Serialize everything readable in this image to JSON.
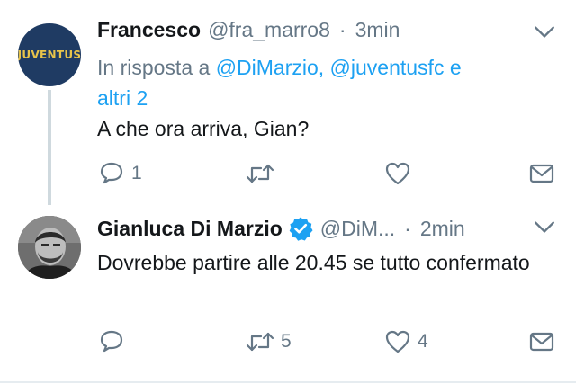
{
  "tweets": [
    {
      "name": "Francesco",
      "handle": "@fra_marro8",
      "separator": "·",
      "time": "3min",
      "avatar_label": "JUVENTUS",
      "reply_prefix": "In risposta a",
      "reply_mentions": "@DiMarzio, @juventusfc e",
      "reply_rest": "altri 2",
      "text": "A che ora arriva, Gian?",
      "reply_count": "1",
      "retweet_count": "",
      "like_count": ""
    },
    {
      "name": "Gianluca Di Marzio",
      "handle": "@DiM...",
      "separator": "·",
      "time": "2min",
      "text": "Dovrebbe partire alle 20.45 se tutto confermato",
      "reply_count": "",
      "retweet_count": "5",
      "like_count": "4"
    }
  ],
  "colors": {
    "accent": "#1da1f2",
    "secondary_text": "#657786",
    "primary_text": "#14171a",
    "thread_line": "#cfd9de",
    "juventus_blue": "#1f3b63",
    "juventus_gold": "#e8c44a"
  },
  "icons": [
    "chevron-down-icon",
    "reply-icon",
    "retweet-icon",
    "like-icon",
    "direct-message-icon",
    "verified-badge-icon"
  ]
}
